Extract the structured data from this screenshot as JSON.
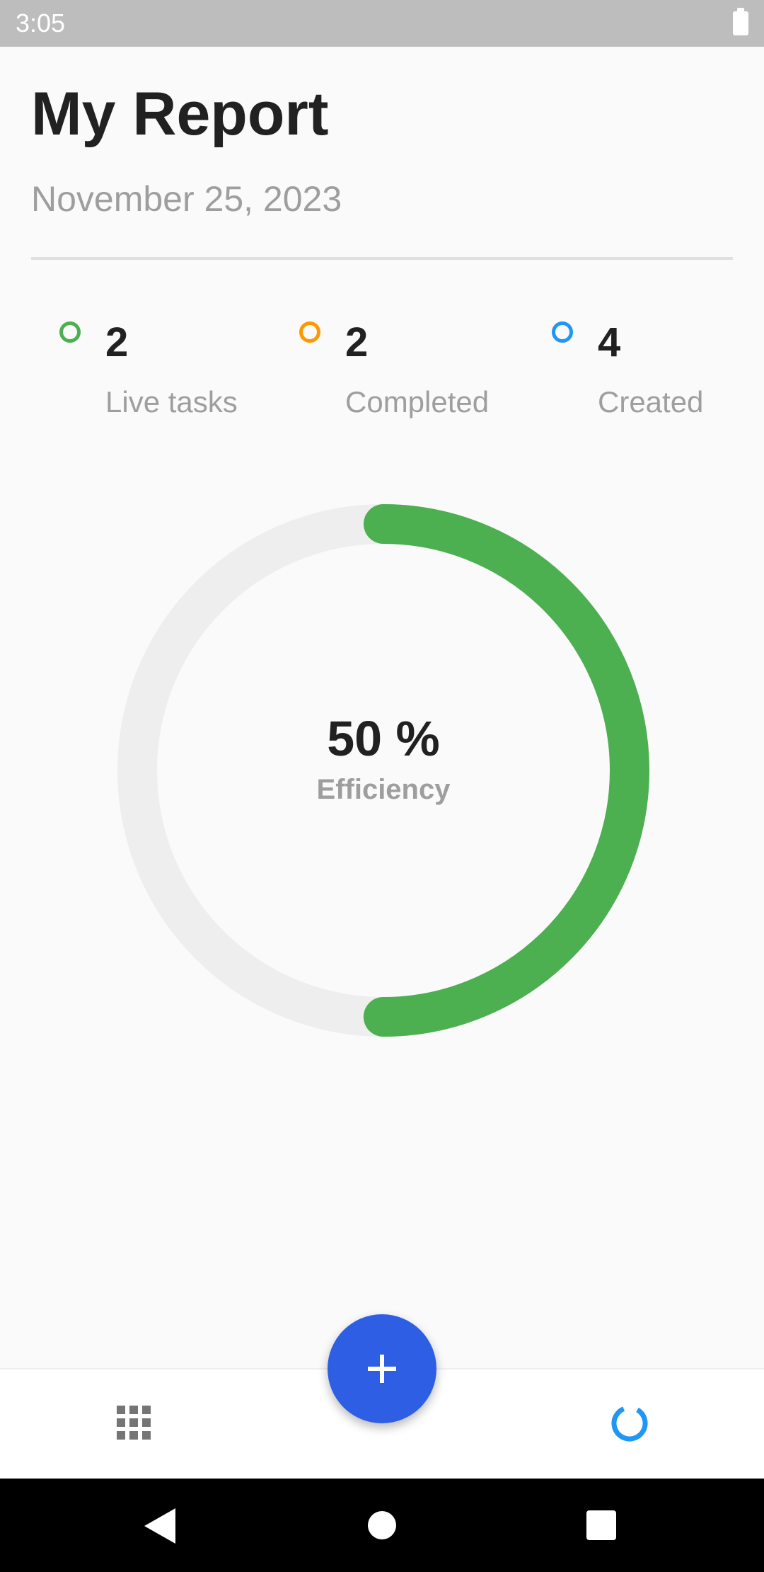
{
  "status_bar": {
    "time": "3:05",
    "battery_icon": "battery-full-icon"
  },
  "header": {
    "title": "My Report",
    "date": "November 25, 2023"
  },
  "stats": [
    {
      "value": "2",
      "label": "Live tasks",
      "color": "#4caf50"
    },
    {
      "value": "2",
      "label": "Completed",
      "color": "#ff9800"
    },
    {
      "value": "4",
      "label": "Created",
      "color": "#2196f3"
    }
  ],
  "efficiency": {
    "percent_text": "50 %",
    "label": "Efficiency",
    "fraction": 0.5,
    "progress_color": "#4caf50",
    "track_color": "#eeeeee"
  },
  "bottom_nav": {
    "left_icon": "grid-icon",
    "right_icon": "donut-chart-icon",
    "fab_icon": "plus-icon",
    "fab_color": "#2e5ee3",
    "active_color": "#2196f3"
  },
  "system_nav": {
    "back_icon": "back-icon",
    "home_icon": "home-icon",
    "recents_icon": "recents-icon"
  }
}
